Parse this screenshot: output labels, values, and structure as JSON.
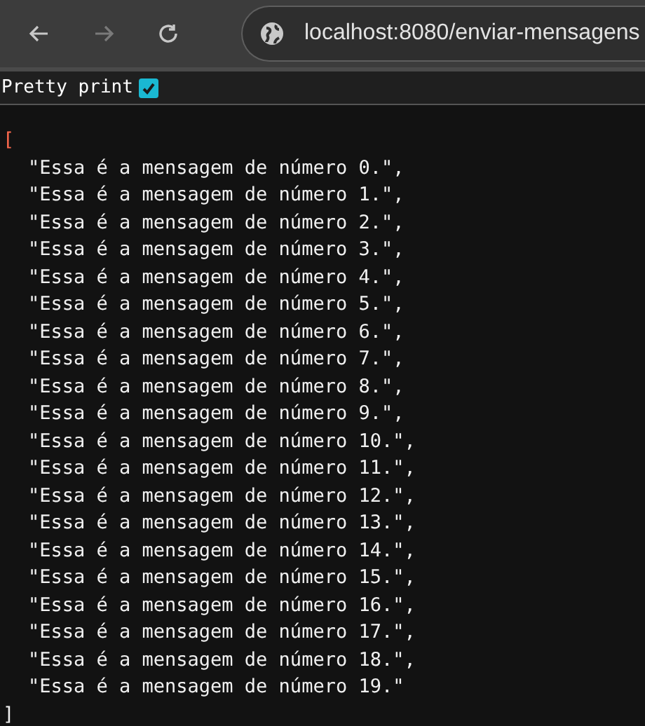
{
  "toolbar": {
    "url": "localhost:8080/enviar-mensagens",
    "forward_disabled": true
  },
  "pretty_print": {
    "label": "Pretty print",
    "checked": true
  },
  "json_view": {
    "open": "[",
    "close": "]",
    "lines": [
      "\"Essa é a mensagem de número 0.\",",
      "\"Essa é a mensagem de número 1.\",",
      "\"Essa é a mensagem de número 2.\",",
      "\"Essa é a mensagem de número 3.\",",
      "\"Essa é a mensagem de número 4.\",",
      "\"Essa é a mensagem de número 5.\",",
      "\"Essa é a mensagem de número 6.\",",
      "\"Essa é a mensagem de número 7.\",",
      "\"Essa é a mensagem de número 8.\",",
      "\"Essa é a mensagem de número 9.\",",
      "\"Essa é a mensagem de número 10.\",",
      "\"Essa é a mensagem de número 11.\",",
      "\"Essa é a mensagem de número 12.\",",
      "\"Essa é a mensagem de número 13.\",",
      "\"Essa é a mensagem de número 14.\",",
      "\"Essa é a mensagem de número 15.\",",
      "\"Essa é a mensagem de número 16.\",",
      "\"Essa é a mensagem de número 17.\",",
      "\"Essa é a mensagem de número 18.\",",
      "\"Essa é a mensagem de número 19.\""
    ]
  }
}
